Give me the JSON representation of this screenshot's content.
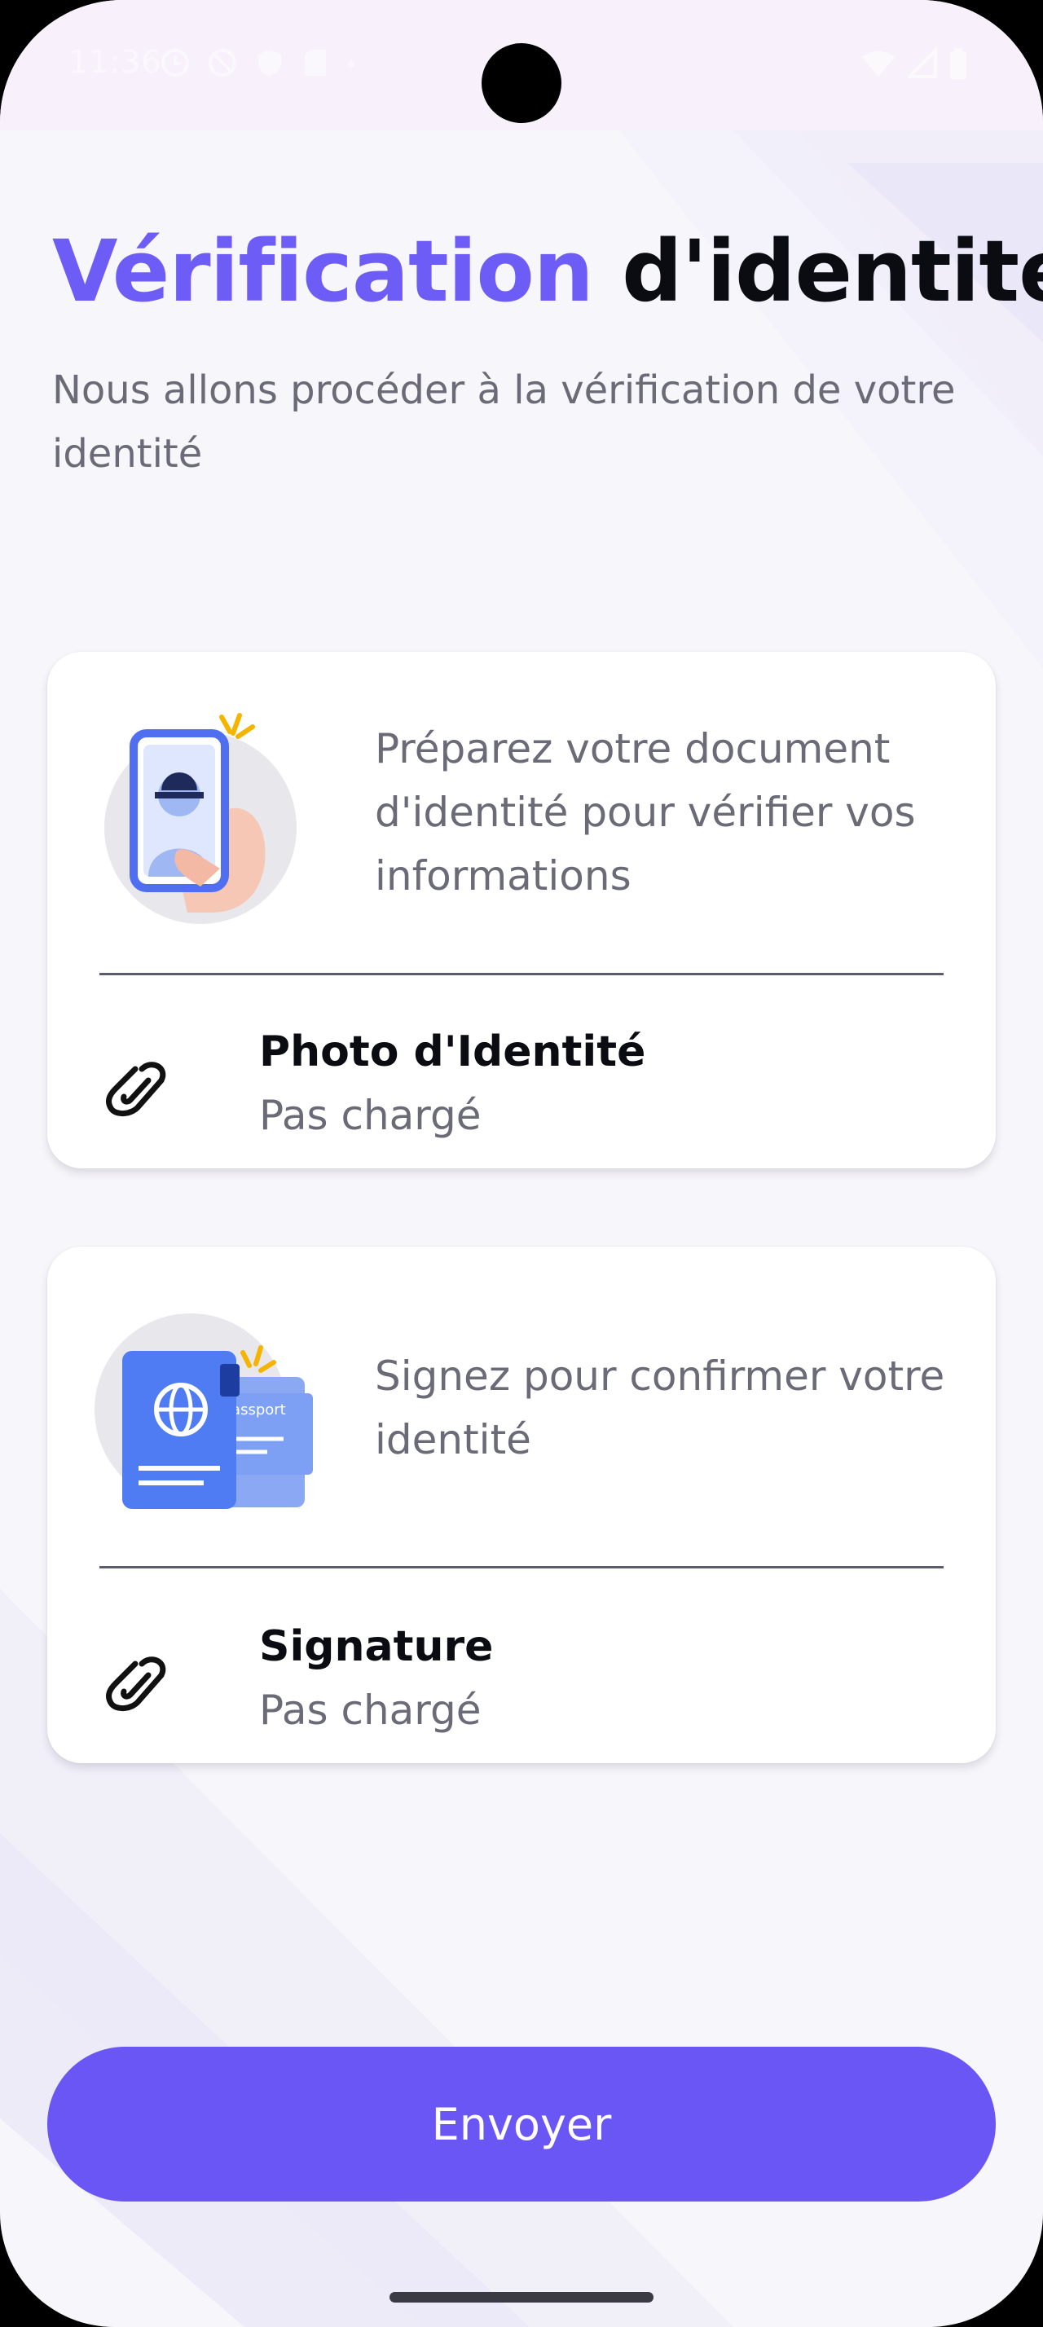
{
  "status_bar": {
    "time": "11:36"
  },
  "header": {
    "title_accent": "Vérification",
    "title_rest": "d'identité",
    "subtitle": "Nous allons procéder à la vérification de votre identité"
  },
  "cards": [
    {
      "illustration_icon": "phone-selfie-illustration",
      "description": "Préparez votre document d'identité pour vérifier vos informations",
      "upload_label": "Photo d'Identité",
      "upload_status": "Pas chargé",
      "upload_icon": "paperclip-icon"
    },
    {
      "illustration_icon": "passport-illustration",
      "description": "Signez pour confirmer votre identité",
      "upload_label": "Signature",
      "upload_status": "Pas chargé",
      "upload_icon": "paperclip-icon",
      "illustration_text": "Passport"
    }
  ],
  "actions": {
    "submit_label": "Envoyer"
  },
  "colors": {
    "accent": "#6e5cf6",
    "button": "#6a56f5",
    "illustration_blue": "#4f7cf2",
    "spark_yellow": "#f5b400"
  }
}
